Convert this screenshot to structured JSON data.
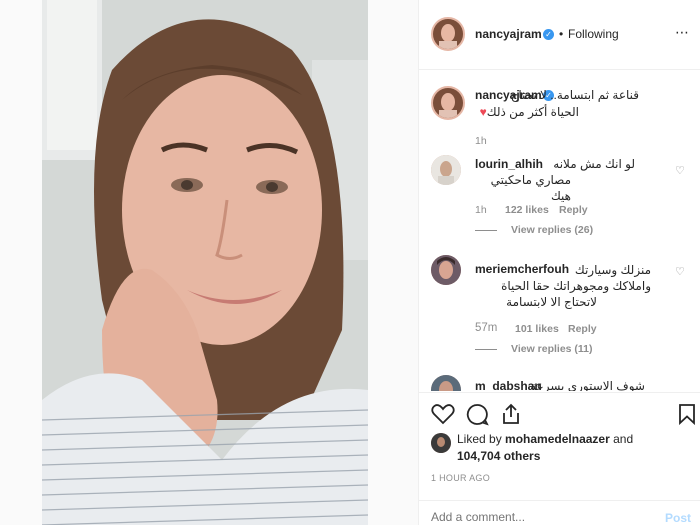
{
  "post": {
    "username": "nancyajram",
    "follow_status": "Following",
    "more_icon": "more-icon"
  },
  "caption": {
    "username": "nancyajram",
    "line1": "قناعة ثم ابتسامة.. لا تحتاج",
    "line2": "الحياة أكثر من ذلك",
    "time": "1h"
  },
  "comments": [
    {
      "username": "lourin_alhih",
      "line1": "لو انك مش ملانه",
      "line2": "مصاري ماحكيتي هيك",
      "time": "1h",
      "likes": "122 likes",
      "reply": "Reply",
      "view_replies": "View replies (26)"
    },
    {
      "username": "meriemcherfouh",
      "line1": "منزلك وسيارتك",
      "line2": "واملاكك ومجوهراتك حقا الحياة",
      "line3": "لاتحتاج الا لابتسامة",
      "time": "57m",
      "likes": "101 likes",
      "reply": "Reply",
      "view_replies": "View replies (11)"
    },
    {
      "username": "m_dabshan",
      "partial_text": "شوف الاستوري بسرعة"
    }
  ],
  "likes": {
    "prefix": "Liked by",
    "user": "mohamedelnaazer",
    "and": "and",
    "count": "104,704 others"
  },
  "timestamp": "1 HOUR AGO",
  "add_comment": {
    "placeholder": "Add a comment...",
    "post_label": "Post"
  },
  "colors": {
    "verified": "#3897f0",
    "muted": "#8e8e8e",
    "post_disabled": "#b3dbff",
    "heart": "#ed4956"
  }
}
